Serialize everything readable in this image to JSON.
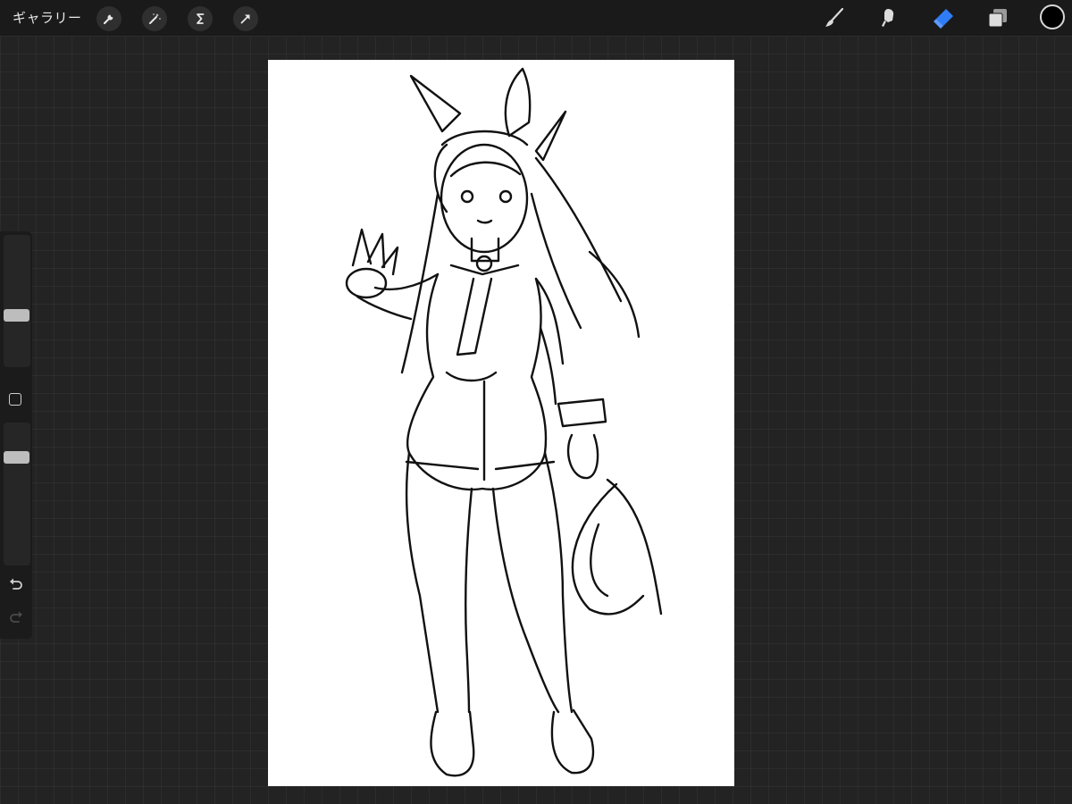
{
  "topbar": {
    "gallery_label": "ギャラリー",
    "left_tools": [
      "wrench-icon",
      "magic-wand-icon",
      "selection-icon",
      "transform-arrow-icon"
    ],
    "right_tools": [
      "brush-icon",
      "smudge-icon",
      "eraser-icon",
      "layers-icon"
    ],
    "active_tool": "eraser",
    "accent_color": "#2f7df6",
    "current_color": "#000000"
  },
  "sidebar": {
    "brush_size_level": 0.38,
    "opacity_level": 0.78,
    "tools": [
      "modify-square-icon",
      "undo-icon",
      "redo-icon"
    ]
  },
  "canvas": {
    "background_color": "#ffffff",
    "content": "line-art-sketch"
  }
}
